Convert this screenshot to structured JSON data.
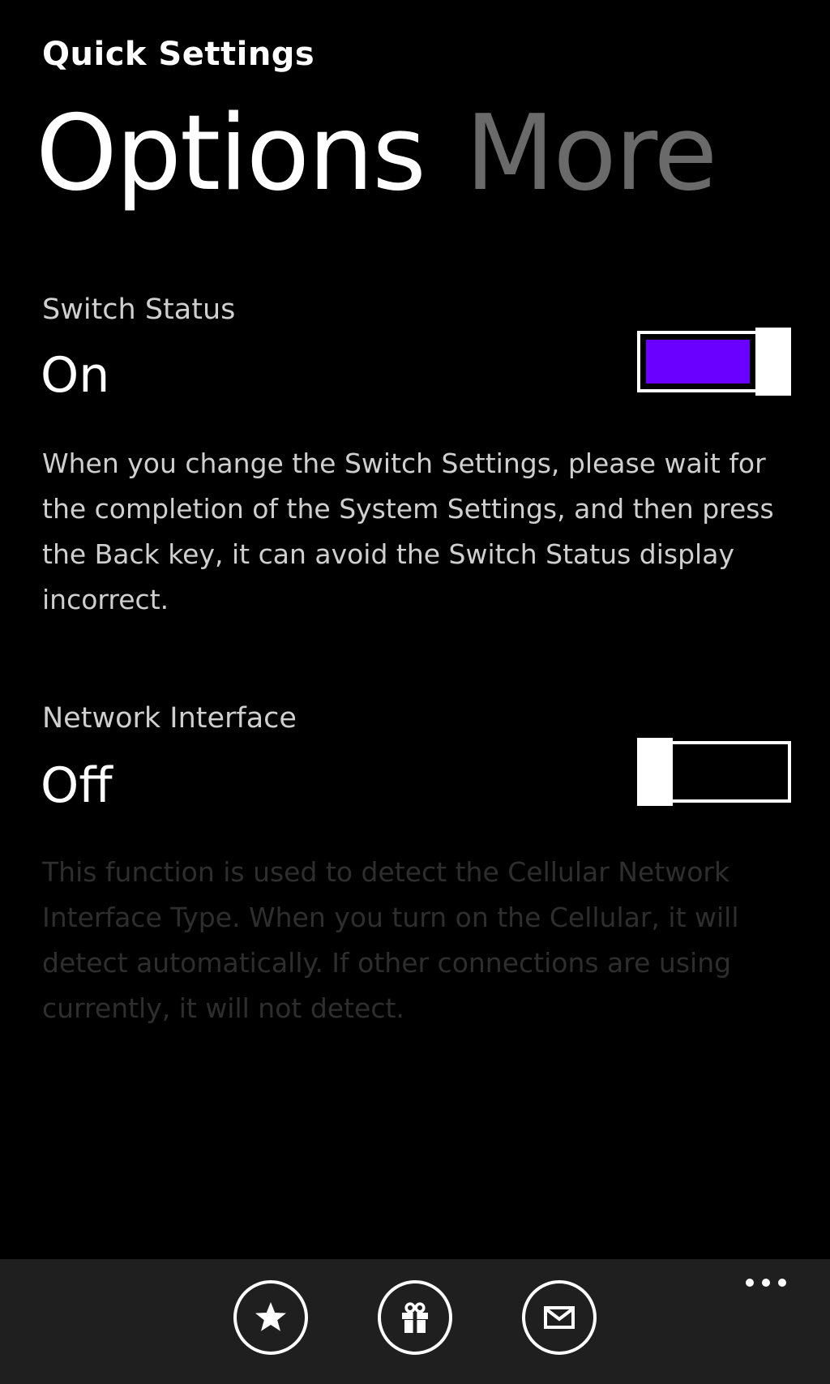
{
  "app": {
    "title": "Quick Settings"
  },
  "pivot": {
    "items": [
      {
        "label": "Options",
        "selected": true
      },
      {
        "label": "More",
        "selected": false
      }
    ]
  },
  "settings": [
    {
      "label": "Switch Status",
      "value": "On",
      "enabled": true,
      "description": "When you change the Switch Settings, please wait for the completion of the System Settings, and then press the Back key, it can avoid the Switch Status display incorrect."
    },
    {
      "label": "Network Interface",
      "value": "Off",
      "enabled": false,
      "description": "This function is used to detect the Cellular Network Interface Type. When you turn on the Cellular, it will detect automatically. If other connections are using currently, it will not detect."
    }
  ],
  "app_bar": {
    "buttons": [
      {
        "icon": "star-icon"
      },
      {
        "icon": "gift-icon"
      },
      {
        "icon": "mail-icon"
      }
    ],
    "more_icon": "ellipsis-icon"
  },
  "colors": {
    "accent": "#6a00ff",
    "background": "#000000",
    "app_bar": "#1f1f1f",
    "inactive_pivot": "#6a6a6a",
    "disabled_text": "#2e2e2e"
  }
}
